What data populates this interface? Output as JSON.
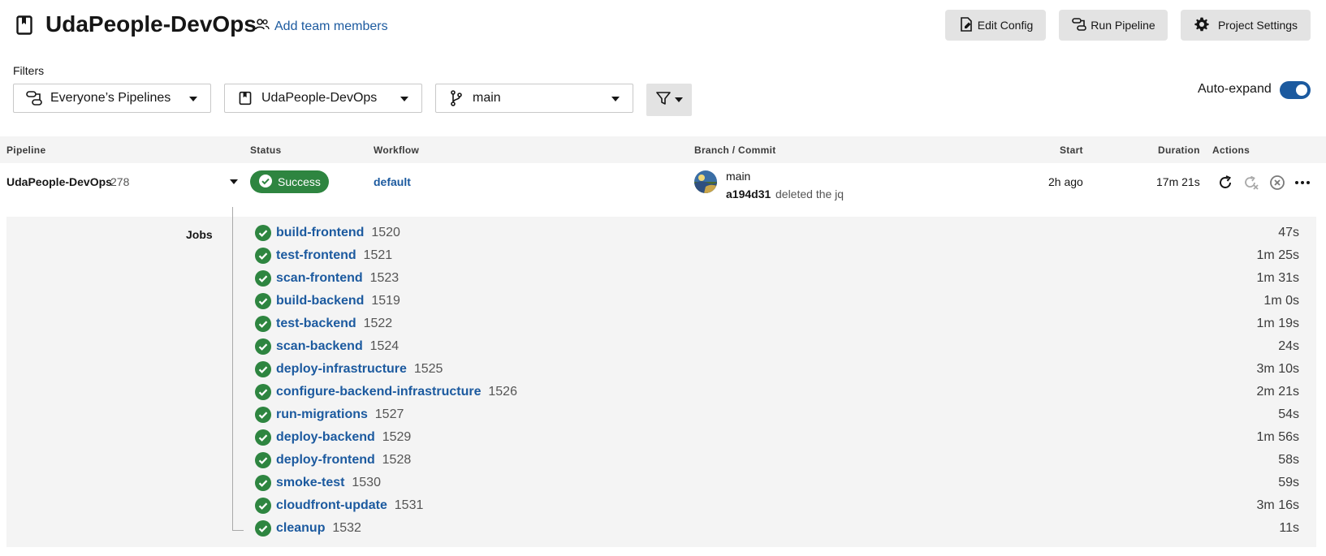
{
  "header": {
    "project_title": "UdaPeople-DevOps",
    "add_team_label": "Add team members",
    "edit_config_label": "Edit Config",
    "run_pipeline_label": "Run Pipeline",
    "project_settings_label": "Project Settings"
  },
  "filters": {
    "label": "Filters",
    "pipelines_filter": "Everyone’s Pipelines",
    "project_filter": "UdaPeople-DevOps",
    "branch_filter": "main",
    "auto_expand_label": "Auto-expand",
    "auto_expand_on": true
  },
  "table": {
    "columns": {
      "pipeline": "Pipeline",
      "status": "Status",
      "workflow": "Workflow",
      "branch_commit": "Branch / Commit",
      "start": "Start",
      "duration": "Duration",
      "actions": "Actions"
    }
  },
  "pipeline": {
    "name": "UdaPeople-DevOps",
    "number": "278",
    "status": "Success",
    "workflow": "default",
    "branch": "main",
    "commit_hash": "a194d31",
    "commit_message": "deleted the jq",
    "start": "2h ago",
    "duration": "17m 21s"
  },
  "jobs_label": "Jobs",
  "jobs": [
    {
      "name": "build-frontend",
      "number": "1520",
      "duration": "47s"
    },
    {
      "name": "test-frontend",
      "number": "1521",
      "duration": "1m 25s"
    },
    {
      "name": "scan-frontend",
      "number": "1523",
      "duration": "1m 31s"
    },
    {
      "name": "build-backend",
      "number": "1519",
      "duration": "1m 0s"
    },
    {
      "name": "test-backend",
      "number": "1522",
      "duration": "1m 19s"
    },
    {
      "name": "scan-backend",
      "number": "1524",
      "duration": "24s"
    },
    {
      "name": "deploy-infrastructure",
      "number": "1525",
      "duration": "3m 10s"
    },
    {
      "name": "configure-backend-infrastructure",
      "number": "1526",
      "duration": "2m 21s"
    },
    {
      "name": "run-migrations",
      "number": "1527",
      "duration": "54s"
    },
    {
      "name": "deploy-backend",
      "number": "1529",
      "duration": "1m 56s"
    },
    {
      "name": "deploy-frontend",
      "number": "1528",
      "duration": "58s"
    },
    {
      "name": "smoke-test",
      "number": "1530",
      "duration": "59s"
    },
    {
      "name": "cloudfront-update",
      "number": "1531",
      "duration": "3m 16s"
    },
    {
      "name": "cleanup",
      "number": "1532",
      "duration": "11s"
    }
  ],
  "colors": {
    "success": "#2e8540",
    "link": "#1c5a9f",
    "button_bg": "#e3e3e3",
    "panel_bg": "#f4f4f4"
  }
}
